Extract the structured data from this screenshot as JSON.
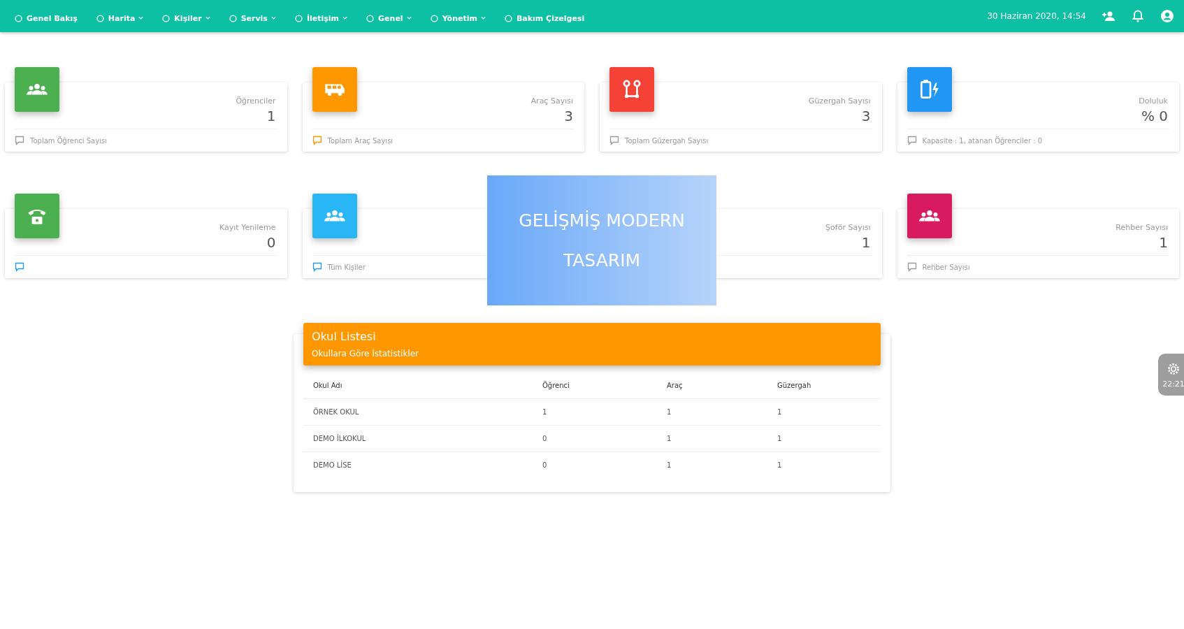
{
  "navbar": {
    "items": [
      {
        "label": "Genel Bakış",
        "dropdown": false
      },
      {
        "label": "Harita",
        "dropdown": true
      },
      {
        "label": "Kişiler",
        "dropdown": true
      },
      {
        "label": "Servis",
        "dropdown": true
      },
      {
        "label": "İletişim",
        "dropdown": true
      },
      {
        "label": "Genel",
        "dropdown": true
      },
      {
        "label": "Yönetim",
        "dropdown": true
      },
      {
        "label": "Bakım Çizelgesi",
        "dropdown": false
      }
    ],
    "datetime": "30 Haziran 2020, 14:54"
  },
  "stat_cards": [
    {
      "color": "#4caf50",
      "title": "Öğrenciler",
      "value": "1",
      "footer": "Toplam Öğrenci Sayısı"
    },
    {
      "color": "#ff9800",
      "title": "Araç Sayısı",
      "value": "3",
      "footer": "Toplam Araç Sayısı"
    },
    {
      "color": "#f44336",
      "title": "Güzergah Sayısı",
      "value": "3",
      "footer": "Toplam Güzergah Sayısı"
    },
    {
      "color": "#2196f3",
      "title": "Doluluk",
      "value": "% 0",
      "footer": "Kapasite : 1, atanan Öğrenciler : 0"
    },
    {
      "color": "#4caf50",
      "title": "Kayıt Yenileme",
      "value": "0"
    },
    {
      "color": "#29b6f6",
      "footer": "Tüm Kişiler"
    },
    {
      "title": "Şoför Sayısı",
      "value": "1"
    },
    {
      "color": "#d81b60",
      "title": "Rehber Sayısı",
      "value": "1",
      "footer": "Rehber Sayısı"
    }
  ],
  "overlay_banner": {
    "lines": [
      "GELİŞMİŞ MODERN",
      "TASARIM"
    ]
  },
  "school_table": {
    "title": "Okul Listesi",
    "subtitle": "Okullara Göre İstatistikler",
    "columns": [
      "Okul Adı",
      "Öğrenci",
      "Araç",
      "Güzergah"
    ],
    "rows": [
      [
        "ÖRNEK OKUL",
        "1",
        "1",
        "1"
      ],
      [
        "DEMO İLKOKUL",
        "0",
        "1",
        "1"
      ],
      [
        "DEMO LİSE",
        "0",
        "1",
        "1"
      ]
    ]
  },
  "settings_widget": {
    "label": "22:21"
  }
}
